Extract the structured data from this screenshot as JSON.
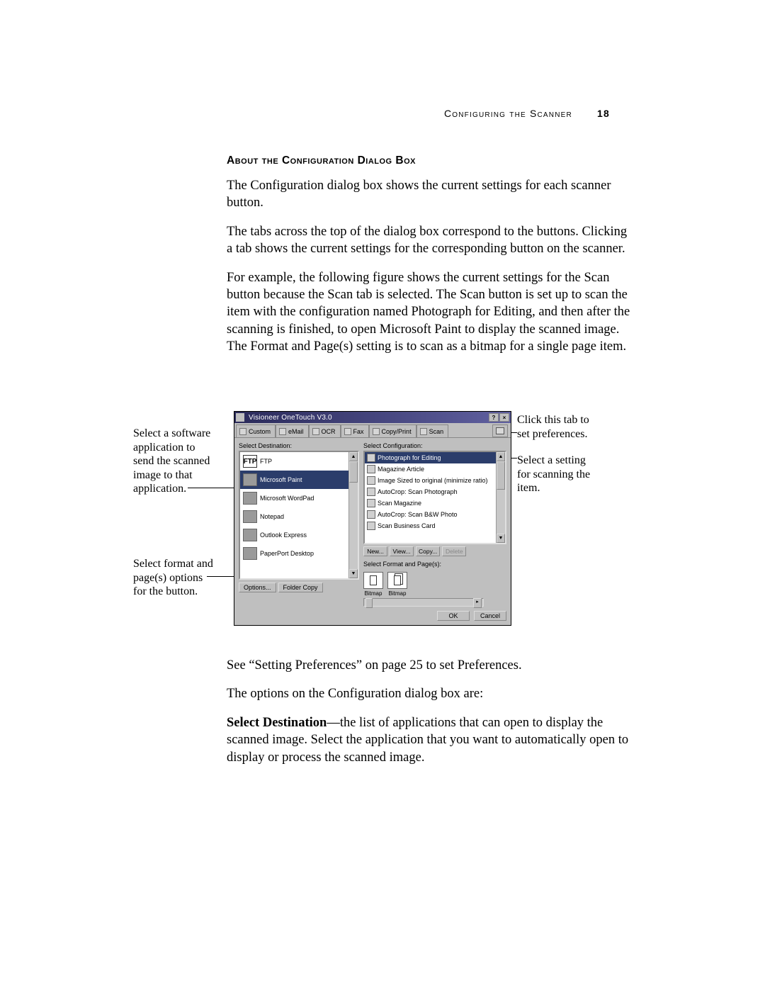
{
  "header": {
    "running_title": "Configuring the Scanner",
    "page_number": "18"
  },
  "heading": "About the Configuration Dialog Box",
  "paragraphs": {
    "p1": "The Configuration dialog box shows the current settings for each scanner button.",
    "p2": "The tabs across the top of the dialog box correspond to the buttons. Clicking a tab shows the current settings for the corresponding button on the scanner.",
    "p3": "For example, the following figure shows the current settings for the Scan button because the Scan tab is selected. The Scan button is set up to scan the item with the configuration named Photograph for Editing, and then after the scanning is finished, to open Microsoft Paint to display the scanned image. The Format and Page(s) setting is to scan as a bitmap for a single page item.",
    "p4": "See “Setting Preferences” on page 25 to set Preferences.",
    "p5": "The options on the Configuration dialog box are:",
    "p6_label": "Select Destination",
    "p6_rest": "—the list of applications that can open to display the scanned image. Select the application that you want to automatically open to display or process the scanned image."
  },
  "callouts": {
    "left1": "Select a software application to send the scanned image to that application.",
    "left2": "Select format and page(s) options for the button.",
    "right1": "Click this tab to set preferences.",
    "right2": "Select a setting for scanning the item."
  },
  "dialog": {
    "title": "Visioneer OneTouch V3.0",
    "tabs": [
      "Custom",
      "eMail",
      "OCR",
      "Fax",
      "Copy/Print",
      "Scan"
    ],
    "pref_tab_icon": "preferences-icon",
    "left_label": "Select Destination:",
    "right_label": "Select Configuration:",
    "destinations": [
      {
        "label": "FTP",
        "icon": "ftp-icon"
      },
      {
        "label": "Microsoft Paint",
        "icon": "mspaint-icon",
        "selected": true
      },
      {
        "label": "Microsoft WordPad",
        "icon": "wordpad-icon"
      },
      {
        "label": "Notepad",
        "icon": "notepad-icon"
      },
      {
        "label": "Outlook Express",
        "icon": "outlook-icon"
      },
      {
        "label": "PaperPort Desktop",
        "icon": "paperport-icon"
      }
    ],
    "configurations": [
      {
        "label": "Photograph for Editing",
        "selected": true
      },
      {
        "label": "Magazine Article"
      },
      {
        "label": "Image Sized to original (minimize ratio)"
      },
      {
        "label": "AutoCrop: Scan Photograph"
      },
      {
        "label": "Scan Magazine"
      },
      {
        "label": "AutoCrop: Scan B&W Photo"
      },
      {
        "label": "Scan Business Card"
      }
    ],
    "conf_buttons": [
      "New...",
      "View...",
      "Copy...",
      "Delete"
    ],
    "format_label": "Select Format and Page(s):",
    "formats": [
      {
        "label": "Bitmap",
        "icon": "single-page-icon"
      },
      {
        "label": "Bitmap",
        "icon": "multi-page-icon"
      }
    ],
    "left_buttons": [
      "Options...",
      "Folder Copy"
    ],
    "dialog_buttons": [
      "OK",
      "Cancel"
    ]
  }
}
